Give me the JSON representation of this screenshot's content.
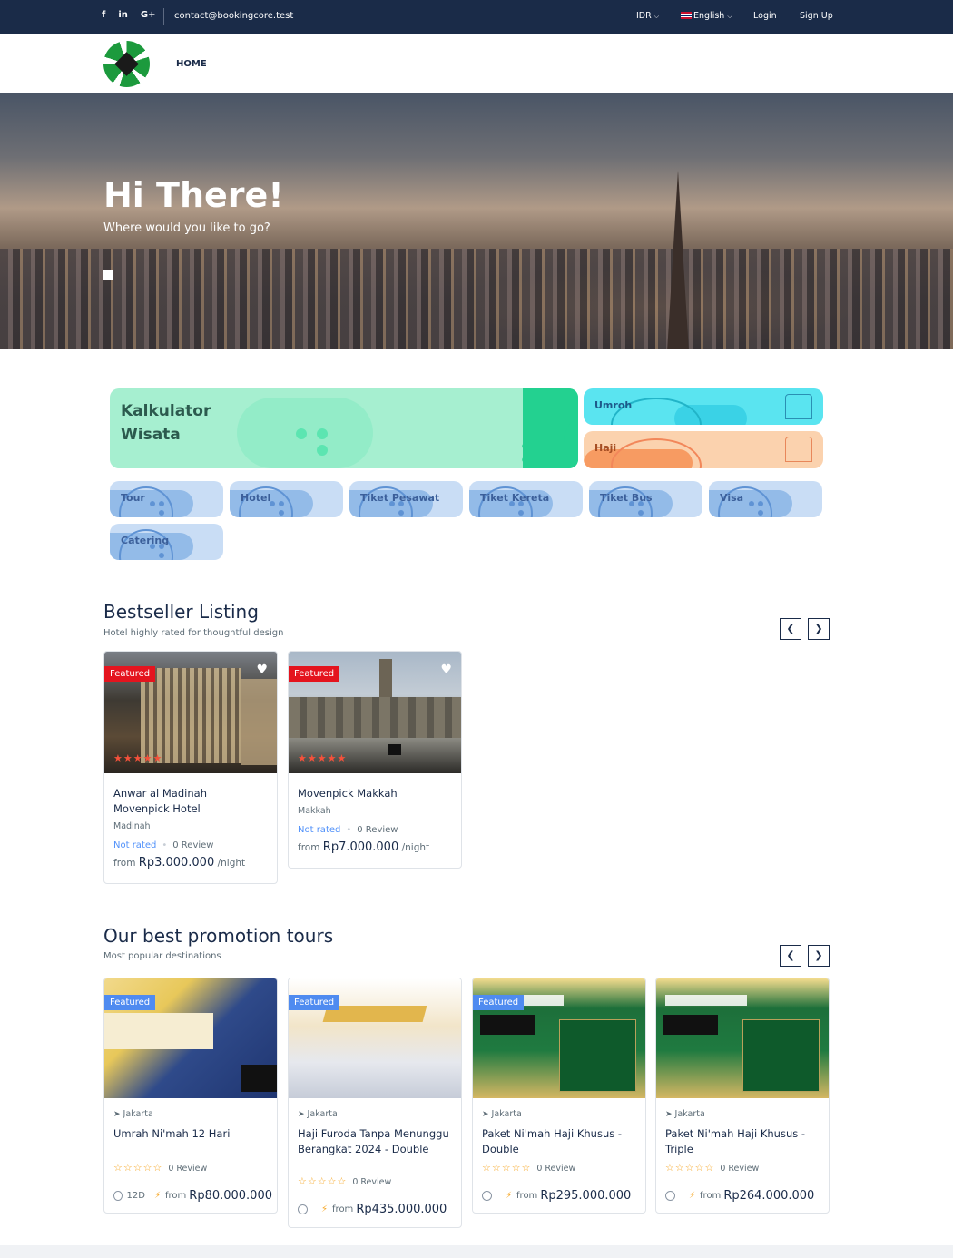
{
  "topbar": {
    "social": [
      "f",
      "in",
      "G+"
    ],
    "email": "contact@bookingcore.test",
    "currency": "IDR",
    "language": "English",
    "login": "Login",
    "signup": "Sign Up"
  },
  "header": {
    "nav_home": "HOME"
  },
  "hero": {
    "title": "Hi There!",
    "subtitle": "Where would you like to go?"
  },
  "categories": {
    "kalkulator": "Kalkulator Wisata",
    "umroh": "Umroh",
    "haji": "Haji",
    "small": [
      "Tour",
      "Hotel",
      "Tiket Pesawat",
      "Tiket Kereta",
      "Tiket Bus",
      "Visa",
      "Catering"
    ]
  },
  "bestseller": {
    "title": "Bestseller Listing",
    "subtitle": "Hotel highly rated for thoughtful design",
    "prev": "❮",
    "next": "❯",
    "items": [
      {
        "badge": "Featured",
        "title": "Anwar al Madinah Movenpick Hotel",
        "location": "Madinah",
        "rating": "Not rated",
        "reviews": "0 Review",
        "from": "from",
        "price": "Rp3.000.000",
        "unit": "/night"
      },
      {
        "badge": "Featured",
        "title": "Movenpick Makkah",
        "location": "Makkah",
        "rating": "Not rated",
        "reviews": "0 Review",
        "from": "from",
        "price": "Rp7.000.000",
        "unit": "/night"
      }
    ]
  },
  "promotion": {
    "title": "Our best promotion tours",
    "subtitle": "Most popular destinations",
    "prev": "❮",
    "next": "❯",
    "items": [
      {
        "badge": "Featured",
        "location": "Jakarta",
        "title": "Umrah Ni'mah 12 Hari",
        "reviews": "0 Review",
        "duration": "12D",
        "from": "from",
        "price": "Rp80.000.000"
      },
      {
        "badge": "Featured",
        "location": "Jakarta",
        "title": "Haji Furoda Tanpa Menunggu Berangkat 2024 - Double",
        "reviews": "0 Review",
        "duration": "",
        "from": "from",
        "price": "Rp435.000.000"
      },
      {
        "badge": "Featured",
        "location": "Jakarta",
        "title": "Paket Ni'mah Haji Khusus - Double",
        "reviews": "0 Review",
        "duration": "",
        "from": "from",
        "price": "Rp295.000.000"
      },
      {
        "badge": "Featured",
        "location": "Jakarta",
        "title": "Paket Ni'mah Haji Khusus - Triple",
        "reviews": "0 Review",
        "duration": "",
        "from": "from",
        "price": "Rp264.000.000"
      }
    ]
  },
  "colors": {
    "topbar": "#1a2b48",
    "featured_red": "#e4141e",
    "featured_blue": "#4f8bf0",
    "link": "#5191fa",
    "star": "#f6a623"
  }
}
